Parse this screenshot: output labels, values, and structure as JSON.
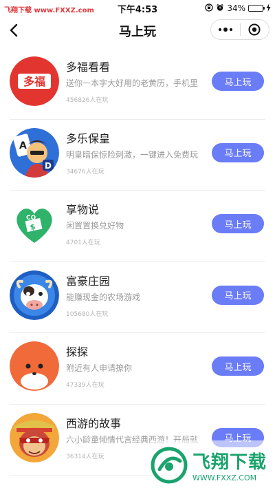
{
  "watermark_top": "飞翔下载 www.FXXZ.com",
  "status_bar": {
    "time": "下午4:53",
    "battery_percent": "34%",
    "battery_level": 0.34
  },
  "nav": {
    "title": "马上玩",
    "more_icon": "more-dots-icon",
    "close_icon": "target-close-icon"
  },
  "colors": {
    "accent": "#6b7cf7",
    "background": "#ffffff",
    "watermark": "#1aa36d"
  },
  "games": [
    {
      "name": "多福看看",
      "description": "送你一本字大好用的老黄历，手机里",
      "players": "456826人在玩",
      "button": "马上玩",
      "icon": "duofu-red-logo-icon"
    },
    {
      "name": "多乐保皇",
      "description": "明皇暗保惊险刺激，一键进入免费玩",
      "players": "34676人在玩",
      "button": "马上玩",
      "icon": "card-king-character-icon"
    },
    {
      "name": "享物说",
      "description": "闲置置换兑好物",
      "players": "4701人在玩",
      "button": "马上玩",
      "icon": "green-heart-gift-icon"
    },
    {
      "name": "富豪庄园",
      "description": "能赚现金的农场游戏",
      "players": "105680人在玩",
      "button": "马上玩",
      "icon": "cow-farm-icon"
    },
    {
      "name": "探探",
      "description": "附近有人申请撩你",
      "players": "47339人在玩",
      "button": "马上玩",
      "icon": "orange-fox-face-icon"
    },
    {
      "name": "西游的故事",
      "description": "六小龄童倾情代言经典西游！开局就",
      "players": "36314人在玩",
      "button": "马上玩",
      "icon": "monkey-king-icon"
    }
  ],
  "watermark_bottom": {
    "brand": "飞翔下载",
    "url": "WWW.FXXZ.COM"
  }
}
